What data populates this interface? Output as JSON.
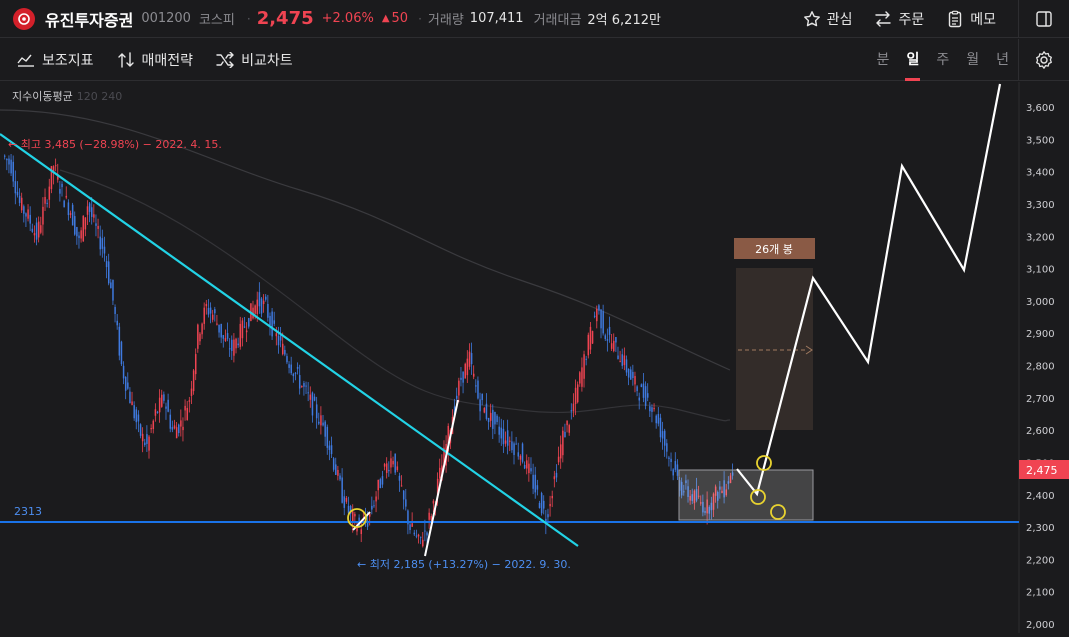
{
  "header": {
    "name": "유진투자증권",
    "code": "001200",
    "market": "코스피",
    "price": "2,475",
    "change_pct": "+2.06%",
    "change": "50",
    "volume_label": "거래량",
    "volume": "107,411",
    "amount_label": "거래대금",
    "amount": "2억 6,212만"
  },
  "actions": {
    "watch": "관심",
    "order": "주문",
    "memo": "메모"
  },
  "toolbar": {
    "indicators": "보조지표",
    "strategy": "매매전략",
    "compare": "비교차트"
  },
  "periods": [
    "분",
    "일",
    "주",
    "월",
    "년"
  ],
  "active_period": "일",
  "colors": {
    "up": "#f04452",
    "down": "#3f7ae0",
    "trend": "#22d3e6",
    "support": "#1a73e8",
    "path": "#ffffff"
  },
  "chart": {
    "ma_label": "지수이동평균",
    "ma_periods_faint": "120  240",
    "high_note": "← 최고 3,485 (−28.98%) − 2022. 4. 15.",
    "low_note": "← 최저 2,185 (+13.27%) − 2022. 9. 30.",
    "support_label": "2313",
    "bars_box_label": "26개 봉",
    "price_tag": "2,475",
    "y_ticks": [
      "3,600",
      "3,500",
      "3,400",
      "3,300",
      "3,200",
      "3,100",
      "3,000",
      "2,900",
      "2,800",
      "2,700",
      "2,600",
      "2,500",
      "2,400",
      "2,300",
      "2,200",
      "2,100",
      "2,000"
    ]
  },
  "chart_data": {
    "type": "candlestick",
    "ylim": [
      2000,
      3650
    ],
    "support_level": 2313,
    "high": {
      "value": 3485,
      "pct": "−28.98%",
      "date": "2022. 4. 15."
    },
    "low": {
      "value": 2185,
      "pct": "+13.27%",
      "date": "2022. 9. 30."
    },
    "last_price": 2475,
    "closes": [
      3450,
      3420,
      3300,
      3260,
      3200,
      3300,
      3420,
      3330,
      3280,
      3180,
      3300,
      3220,
      3150,
      3000,
      2800,
      2700,
      2600,
      2550,
      2650,
      2700,
      2600,
      2620,
      2700,
      2900,
      2980,
      2950,
      2880,
      2850,
      2900,
      2950,
      3000,
      2980,
      2900,
      2850,
      2800,
      2750,
      2700,
      2650,
      2600,
      2500,
      2400,
      2330,
      2300,
      2320,
      2400,
      2480,
      2520,
      2400,
      2300,
      2250,
      2300,
      2400,
      2520,
      2650,
      2760,
      2820,
      2700,
      2650,
      2620,
      2580,
      2560,
      2530,
      2470,
      2400,
      2330,
      2450,
      2580,
      2650,
      2760,
      2870,
      2980,
      2900,
      2860,
      2820,
      2760,
      2720,
      2700,
      2640,
      2560,
      2480,
      2420,
      2400,
      2380,
      2360,
      2400,
      2420,
      2475
    ]
  }
}
